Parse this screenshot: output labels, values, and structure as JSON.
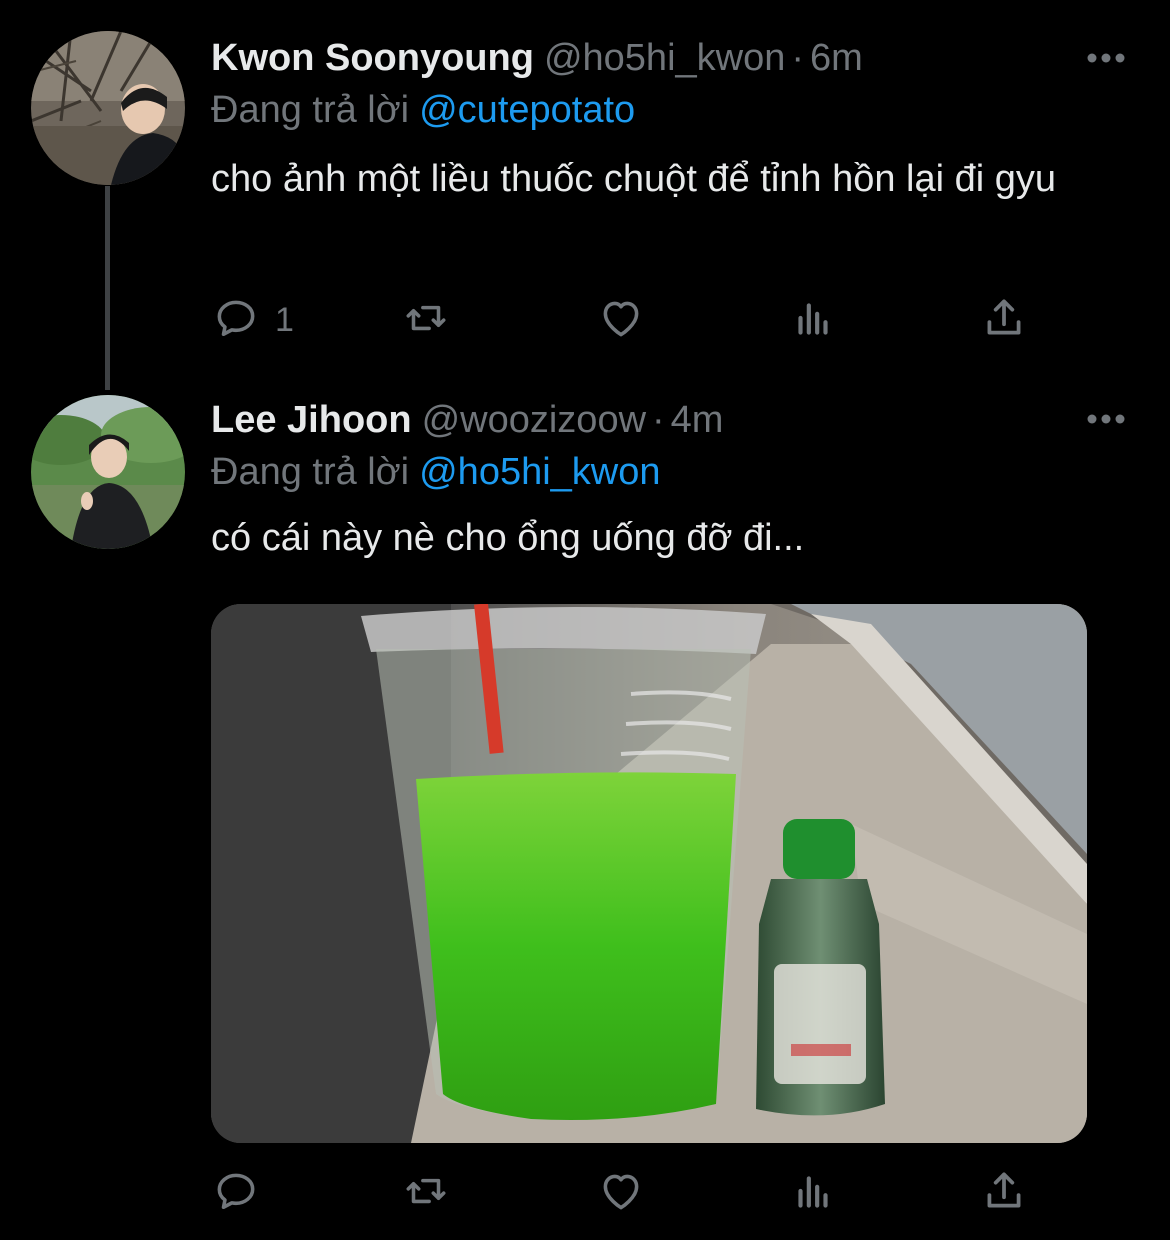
{
  "colors": {
    "background": "#000000",
    "primary_text": "#e7e9ea",
    "secondary_text": "#71767b",
    "link": "#1d9bf0",
    "thread_line": "#3e4144"
  },
  "icons": [
    "more-icon",
    "reply-icon",
    "retweet-icon",
    "like-icon",
    "views-icon",
    "share-icon"
  ],
  "tweets": [
    {
      "display_name": "Kwon Soonyoung",
      "handle": "@ho5hi_kwon",
      "separator": "·",
      "time": "6m",
      "reply_prefix": "Đang trả lời",
      "reply_to": "@cutepotato",
      "text": "cho ảnh một liều thuốc chuột để tỉnh hồn lại đi gyu",
      "reply_count": "1"
    },
    {
      "display_name": "Lee Jihoon",
      "handle": "@woozizoow",
      "separator": "·",
      "time": "4m",
      "reply_prefix": "Đang trả lời",
      "reply_to": "@ho5hi_kwon",
      "text": "có cái này nè cho ổng uống đỡ đi...",
      "reply_count": ""
    }
  ]
}
